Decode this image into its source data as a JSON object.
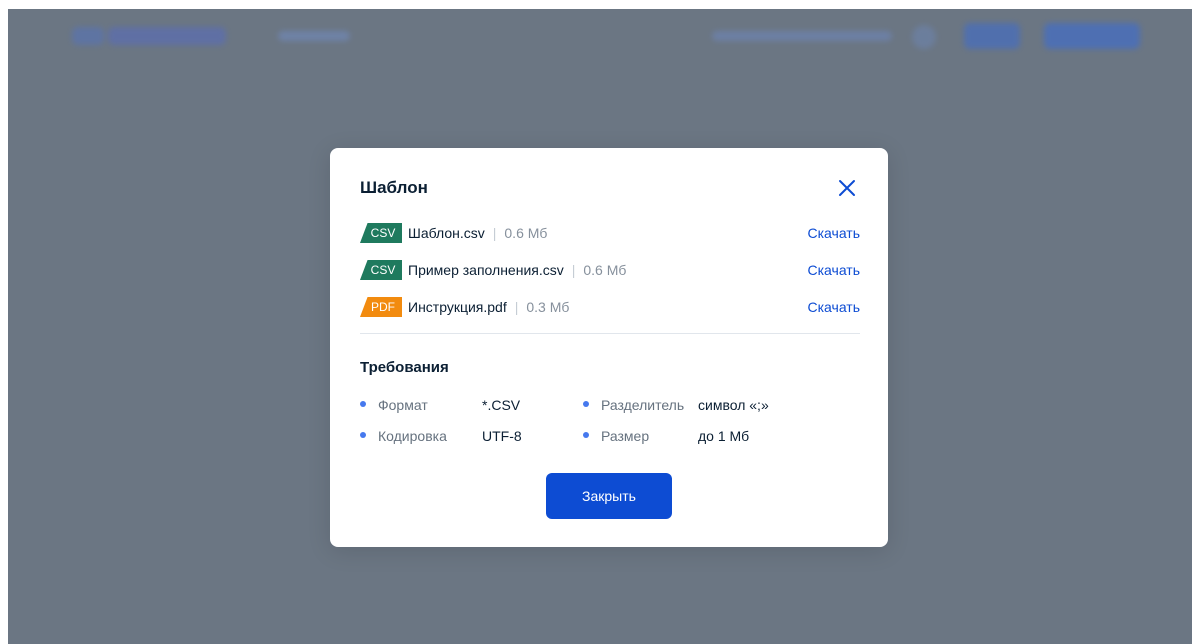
{
  "modal": {
    "title": "Шаблон",
    "close_icon": "close-icon",
    "files": [
      {
        "badge": "CSV",
        "badge_color": "#1f7a5e",
        "name": "Шаблон.csv",
        "separator": "|",
        "size": "0.6 Мб",
        "action": "Скачать"
      },
      {
        "badge": "CSV",
        "badge_color": "#1f7a5e",
        "name": "Пример заполнения.csv",
        "separator": "|",
        "size": "0.6 Мб",
        "action": "Скачать"
      },
      {
        "badge": "PDF",
        "badge_color": "#f28b0f",
        "name": "Инструкция.pdf",
        "separator": "|",
        "size": "0.3 Мб",
        "action": "Скачать"
      }
    ],
    "requirements": {
      "title": "Требования",
      "items": [
        {
          "label": "Формат",
          "value": "*.CSV"
        },
        {
          "label": "Кодировка",
          "value": "UTF-8"
        },
        {
          "label": "Разделитель",
          "value": "символ «;»"
        },
        {
          "label": "Размер",
          "value": "до 1 Мб"
        }
      ]
    },
    "close_button_label": "Закрыть"
  },
  "colors": {
    "accent": "#0d4cd3",
    "overlay": "#6b7683",
    "text": "#0b1f33",
    "muted": "#86909c",
    "bullet": "#4679ee"
  }
}
